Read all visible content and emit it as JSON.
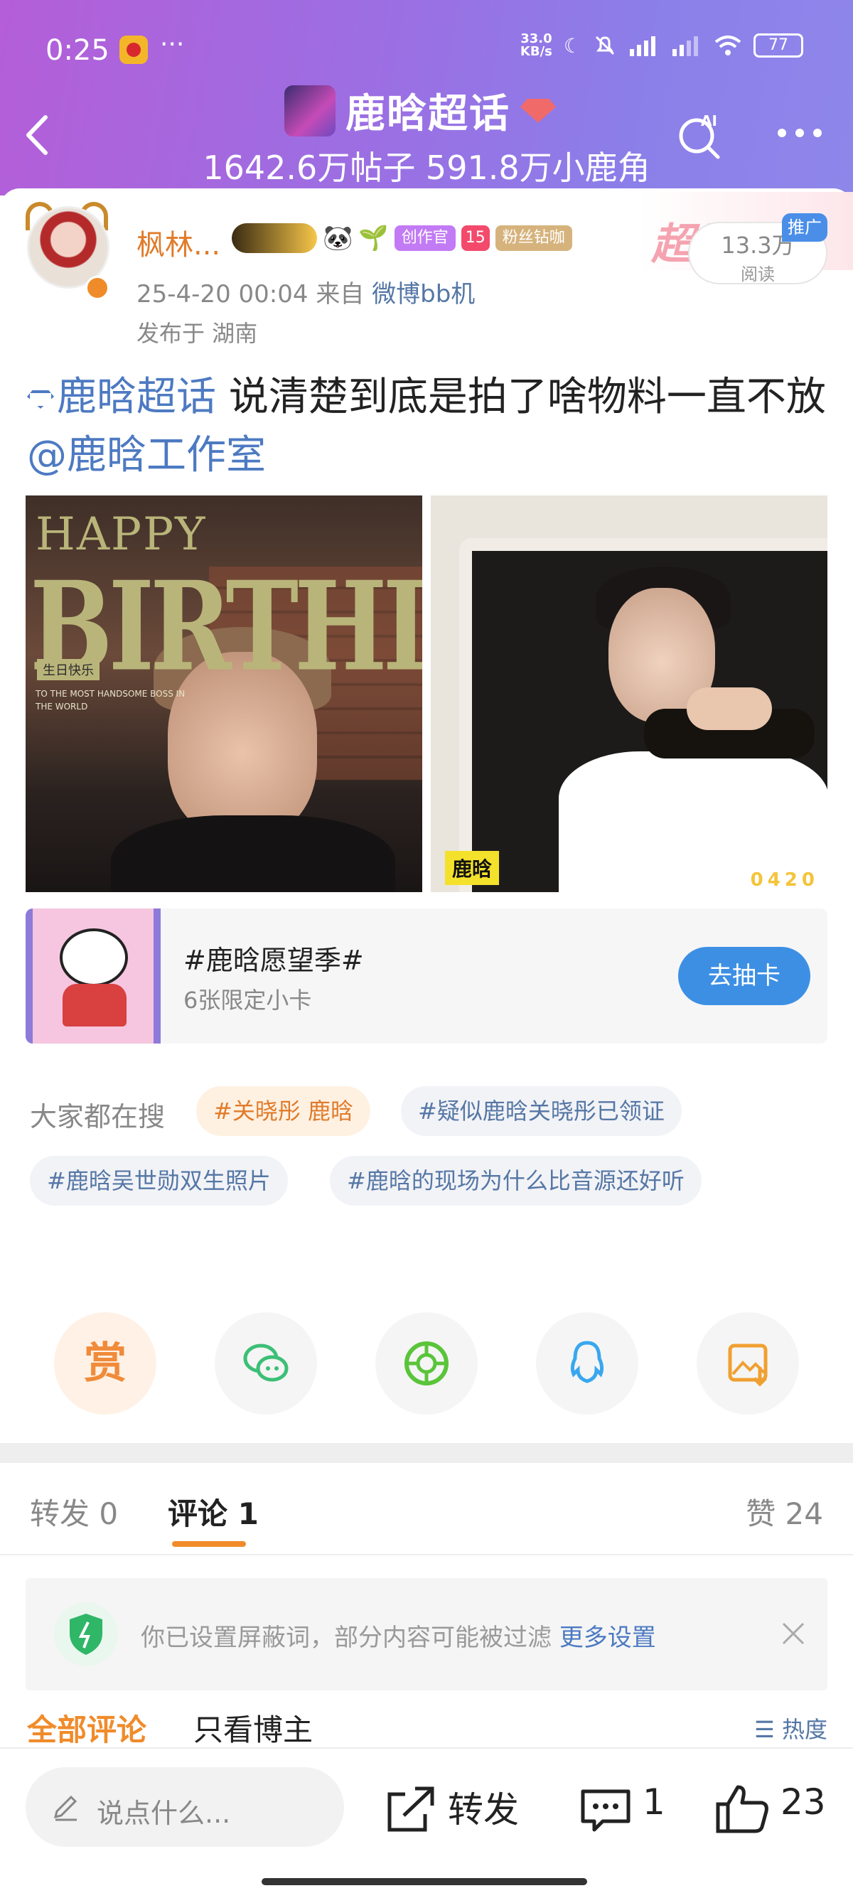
{
  "status_bar": {
    "time": "0:25",
    "net_speed_value": "33.0",
    "net_speed_unit": "KB/s",
    "battery": "77"
  },
  "header": {
    "title": "鹿晗超话",
    "subtitle": "1642.6万帖子 591.8万小鹿角",
    "ai_label": "AI"
  },
  "post": {
    "username": "枫林...",
    "badge_create": "创作官",
    "badge_level": "15",
    "badge_fan": "粉丝钻咖",
    "date": "25-4-20 00:04",
    "source_prefix": "来自",
    "source": "微博bb机",
    "location": "发布于 湖南",
    "reads": "13.3万",
    "reads_label": "阅读",
    "promo_tag": "推广",
    "promo_text": "超话",
    "text_tag": "鹿晗超话",
    "text_body": "说清楚到底是拍了啥物料一直不放",
    "text_mention": "@鹿晗工作室",
    "image1": {
      "line1": "HAPPY",
      "line2": "BIRTHDAY",
      "stamp": "生日快乐",
      "small": "TO THE MOST HANDSOME BOSS IN THE WORLD"
    },
    "image2": {
      "label": "鹿晗",
      "number": "0420"
    }
  },
  "card_ad": {
    "title": "#鹿晗愿望季#",
    "subtitle": "6张限定小卡",
    "button": "去抽卡"
  },
  "search": {
    "label": "大家都在搜",
    "chips": [
      "#关晓彤 鹿晗",
      "#疑似鹿晗关晓彤已领证",
      "#鹿晗吴世勋双生照片",
      "#鹿晗的现场为什么比音源还好听"
    ]
  },
  "share": {
    "reward": "赏"
  },
  "tabs": {
    "repost": "转发 0",
    "comment": "评论 1",
    "like": "赞 24"
  },
  "notice": {
    "text": "你已设置屏蔽词，部分内容可能被过滤",
    "link": "更多设置"
  },
  "filter": {
    "all": "全部评论",
    "author_only": "只看博主",
    "sort": "热度"
  },
  "bottom_bar": {
    "placeholder": "说点什么...",
    "repost": "转发",
    "comments": "1",
    "likes": "23"
  },
  "colors": {
    "accent_orange": "#f08b2a",
    "link_blue": "#4d7ac2",
    "header_purple": "#9b6fe3"
  }
}
